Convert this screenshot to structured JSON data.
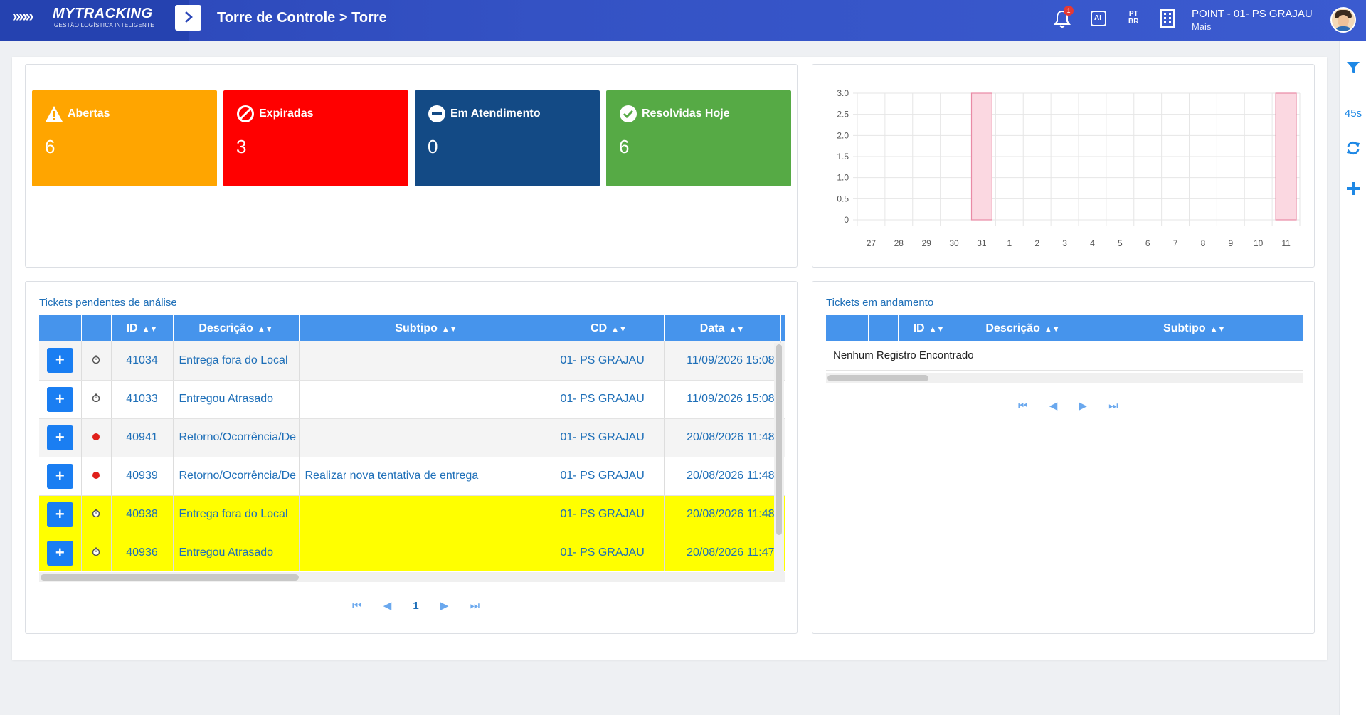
{
  "header": {
    "logo_mark": "»»»",
    "logo_text": "MYTRACKING",
    "logo_subtitle": "GESTÃO LOGÍSTICA INTELIGENTE",
    "breadcrumb": "Torre de Controle > Torre",
    "notification_count": "1",
    "ai_label": "AI",
    "lang_top": "PT",
    "lang_bottom": "BR",
    "point_title": "POINT - 01- PS GRAJAU",
    "point_sub": "Mais"
  },
  "rail": {
    "timer": "45s"
  },
  "cards": [
    {
      "title": "Abertas",
      "value": "6",
      "color": "#ffa500",
      "icon": "warning-icon"
    },
    {
      "title": "Expiradas",
      "value": "3",
      "color": "#ff0000",
      "icon": "blocked-icon"
    },
    {
      "title": "Em Atendimento",
      "value": "0",
      "color": "#134a85",
      "icon": "minus-circle-icon"
    },
    {
      "title": "Resolvidas Hoje",
      "value": "6",
      "color": "#56aa45",
      "icon": "check-circle-icon"
    }
  ],
  "chart_data": {
    "type": "bar",
    "categories": [
      "27",
      "28",
      "29",
      "30",
      "31",
      "1",
      "2",
      "3",
      "4",
      "5",
      "6",
      "7",
      "8",
      "9",
      "10",
      "11"
    ],
    "values": [
      0,
      0,
      0,
      0,
      3,
      0,
      0,
      0,
      0,
      0,
      0,
      0,
      0,
      0,
      0,
      3
    ],
    "ylim": [
      0,
      3
    ],
    "yticks": [
      "0",
      "0.5",
      "1.0",
      "1.5",
      "2.0",
      "2.5",
      "3.0"
    ],
    "grid": true,
    "bar_color": "#fbd8e1",
    "bar_border": "#e98aa5"
  },
  "pending": {
    "title": "Tickets pendentes de análise",
    "columns": [
      "",
      "",
      "ID",
      "Descrição",
      "Subtipo",
      "CD",
      "Data"
    ],
    "rows": [
      {
        "id": "41034",
        "descricao": "Entrega fora do Local",
        "subtipo": "",
        "cd": "01- PS GRAJAU",
        "data": "11/09/2026 15:08",
        "status": "clock",
        "bg": "gray"
      },
      {
        "id": "41033",
        "descricao": "Entregou Atrasado",
        "subtipo": "",
        "cd": "01- PS GRAJAU",
        "data": "11/09/2026 15:08",
        "status": "clock",
        "bg": "white"
      },
      {
        "id": "40941",
        "descricao": "Retorno/Ocorrência/De",
        "subtipo": "",
        "cd": "01- PS GRAJAU",
        "data": "20/08/2026 11:48",
        "status": "red",
        "bg": "gray"
      },
      {
        "id": "40939",
        "descricao": "Retorno/Ocorrência/De",
        "subtipo": "Realizar nova tentativa de entrega",
        "cd": "01- PS GRAJAU",
        "data": "20/08/2026 11:48",
        "status": "red",
        "bg": "white"
      },
      {
        "id": "40938",
        "descricao": "Entrega fora do Local",
        "subtipo": "",
        "cd": "01- PS GRAJAU",
        "data": "20/08/2026 11:48",
        "status": "clock",
        "bg": "yellow"
      },
      {
        "id": "40936",
        "descricao": "Entregou Atrasado",
        "subtipo": "",
        "cd": "01- PS GRAJAU",
        "data": "20/08/2026 11:47",
        "status": "clock",
        "bg": "yellow"
      }
    ],
    "page": "1"
  },
  "inprogress": {
    "title": "Tickets em andamento",
    "columns": [
      "",
      "",
      "ID",
      "Descrição",
      "Subtipo"
    ],
    "empty_text": "Nenhum Registro Encontrado"
  },
  "pager_icons": {
    "first": "⏮",
    "prev": "◀",
    "next": "▶",
    "last": "⏭"
  }
}
